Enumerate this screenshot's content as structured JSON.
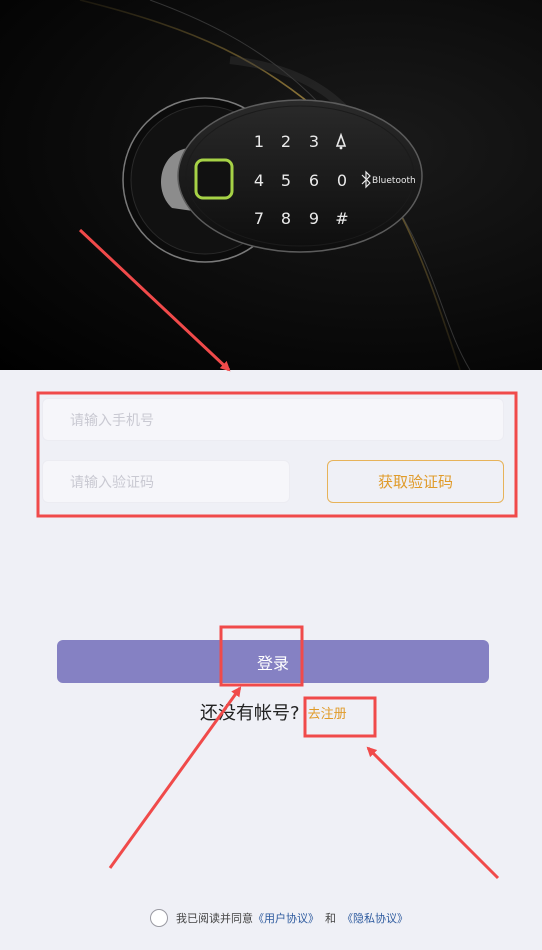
{
  "hero": {
    "keypad_keys": [
      "1",
      "2",
      "3",
      "4",
      "5",
      "6",
      "0",
      "7",
      "8",
      "9",
      "#"
    ],
    "bluetooth_label": "Bluetooth"
  },
  "form": {
    "phone_placeholder": "请输入手机号",
    "code_placeholder": "请输入验证码",
    "get_code_label": "获取验证码",
    "login_label": "登录",
    "register_prompt": "还没有帐号?",
    "register_link": "去注册"
  },
  "agreement": {
    "prefix": "我已阅读并同意",
    "user_agreement": "《用户协议》",
    "and": "和",
    "privacy_policy": "《隐私协议》"
  },
  "annotation_color": "#f04a4a"
}
